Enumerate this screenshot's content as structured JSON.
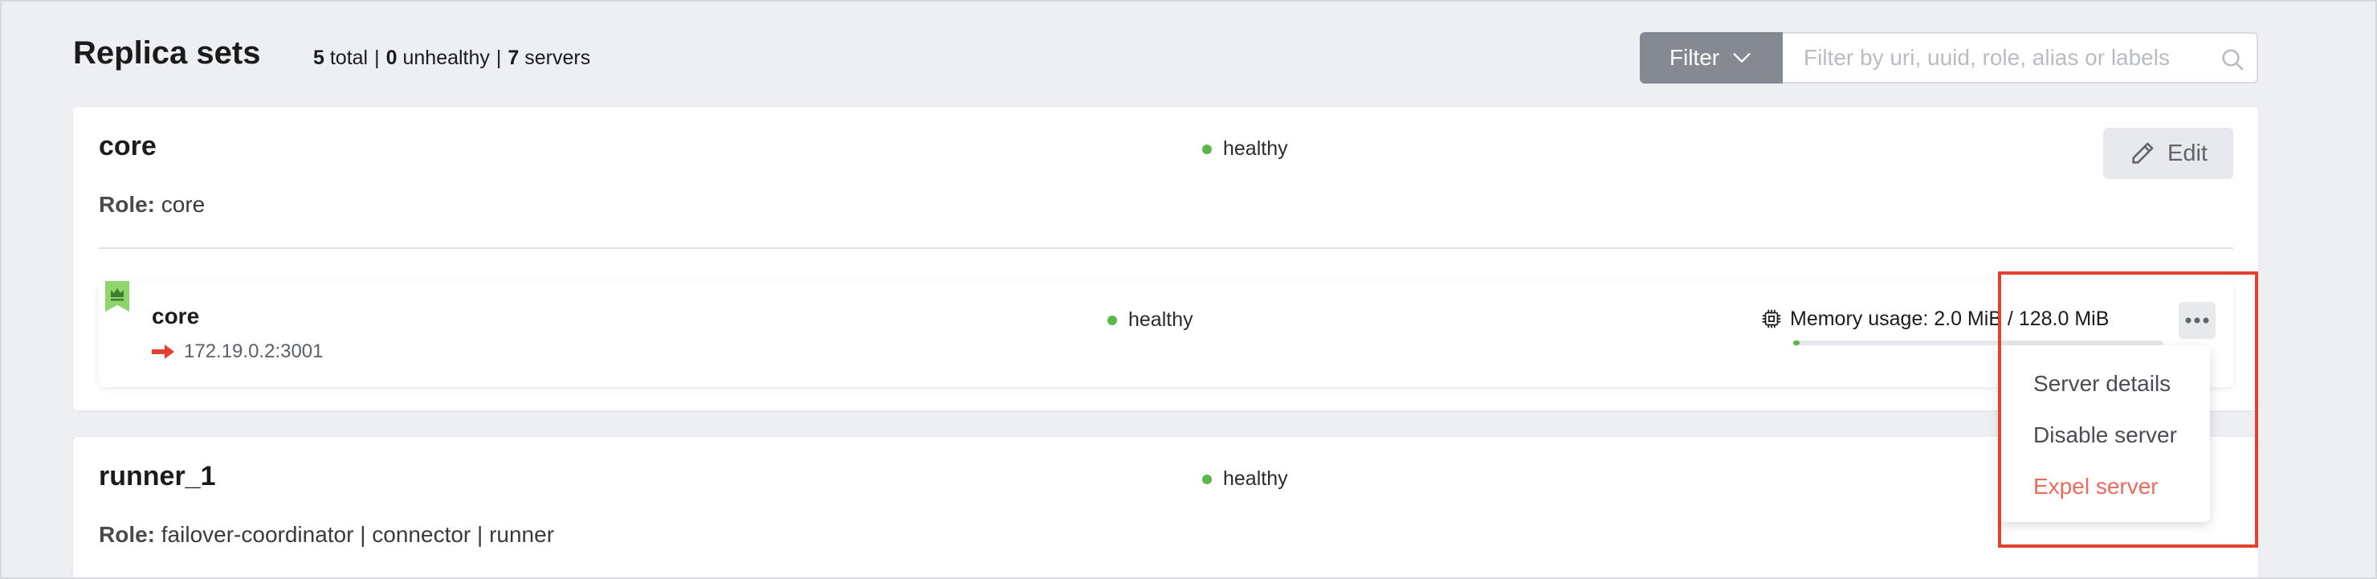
{
  "header": {
    "title": "Replica sets",
    "summary": {
      "total_count": "5",
      "total_label": "total",
      "unhealthy_count": "0",
      "unhealthy_label": "unhealthy",
      "servers_count": "7",
      "servers_label": "servers",
      "separator": "|"
    },
    "filter_label": "Filter",
    "search_placeholder": "Filter by uri, uuid, role, alias or labels"
  },
  "replica_sets": [
    {
      "name": "core",
      "status": "healthy",
      "role_label": "Role:",
      "roles": "core",
      "edit_label": "Edit",
      "servers": [
        {
          "name": "core",
          "uri": "172.19.0.2:3001",
          "status": "healthy",
          "memory_text": "Memory usage: 2.0 MiB / 128.0 MiB",
          "memory_fraction": 0.0156,
          "is_leader": true
        }
      ]
    },
    {
      "name": "runner_1",
      "status": "healthy",
      "role_label": "Role:",
      "roles": "failover-coordinator | connector | runner"
    }
  ],
  "server_menu": {
    "items": [
      {
        "label": "Server details",
        "variant": "normal"
      },
      {
        "label": "Disable server",
        "variant": "normal"
      },
      {
        "label": "Expel server",
        "variant": "danger"
      }
    ]
  },
  "colors": {
    "healthy": "#5bb848",
    "danger": "#ec6a5e",
    "highlight": "#e5402f",
    "filter_bg": "#858a92",
    "leader_badge": "#8fd66a"
  },
  "icons": {
    "filter": "chevron-down-icon",
    "search": "search-icon",
    "edit": "pencil-icon",
    "leader": "crown-icon",
    "uri": "arrow-right-icon",
    "memory": "chip-icon",
    "more": "more-horizontal-icon"
  }
}
